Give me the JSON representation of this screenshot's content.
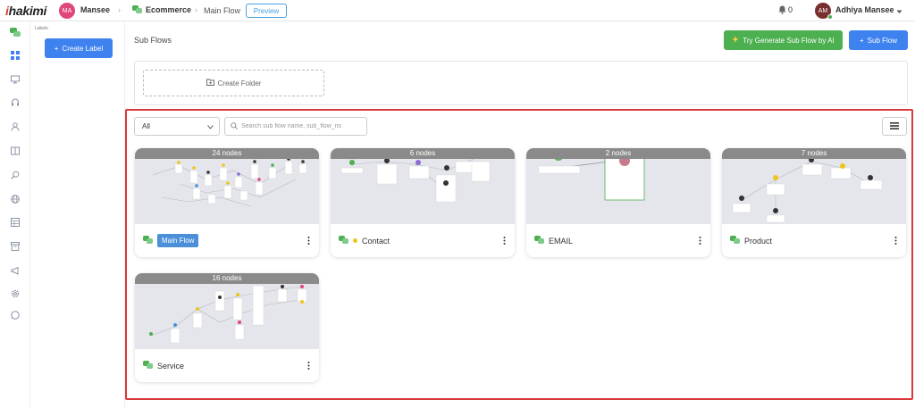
{
  "topbar": {
    "logo": "hakimi",
    "bot_avatar": "MA",
    "bot_name": "Mansee",
    "flow_name": "Ecommerce",
    "breadcrumb_current": "Main Flow",
    "preview_label": "Preview",
    "notification_count": "0",
    "user_avatar": "AM",
    "user_name": "Adhiya Mansee"
  },
  "sidebar": {
    "labels_title": "Labels",
    "create_label": "Create Label",
    "icons": [
      "chat-bubbles-icon",
      "dashboard-icon",
      "inbox-icon",
      "headset-icon",
      "contacts-icon",
      "book-icon",
      "search-icon",
      "globe-icon",
      "table-icon",
      "archive-icon",
      "megaphone-icon",
      "settings-icon",
      "whatsapp-icon"
    ]
  },
  "main": {
    "title": "Sub Flows",
    "ai_button": "Try Generate Sub Flow by AI",
    "subflow_button": "Sub Flow",
    "create_folder": "Create Folder",
    "filter_value": "All",
    "search_placeholder": "Search sub flow name, sub_flow_ns"
  },
  "cards": [
    {
      "nodes": "24 nodes",
      "name": "Main Flow"
    },
    {
      "nodes": "6 nodes",
      "name": "Contact"
    },
    {
      "nodes": "2 nodes",
      "name": "EMAIL"
    },
    {
      "nodes": "7 nodes",
      "name": "Product"
    },
    {
      "nodes": "16 nodes",
      "name": "Service"
    }
  ],
  "colors": {
    "primary": "#3d82ee",
    "success": "#4caf50",
    "highlight": "#d9383a",
    "badge": "#4a8fd8"
  }
}
